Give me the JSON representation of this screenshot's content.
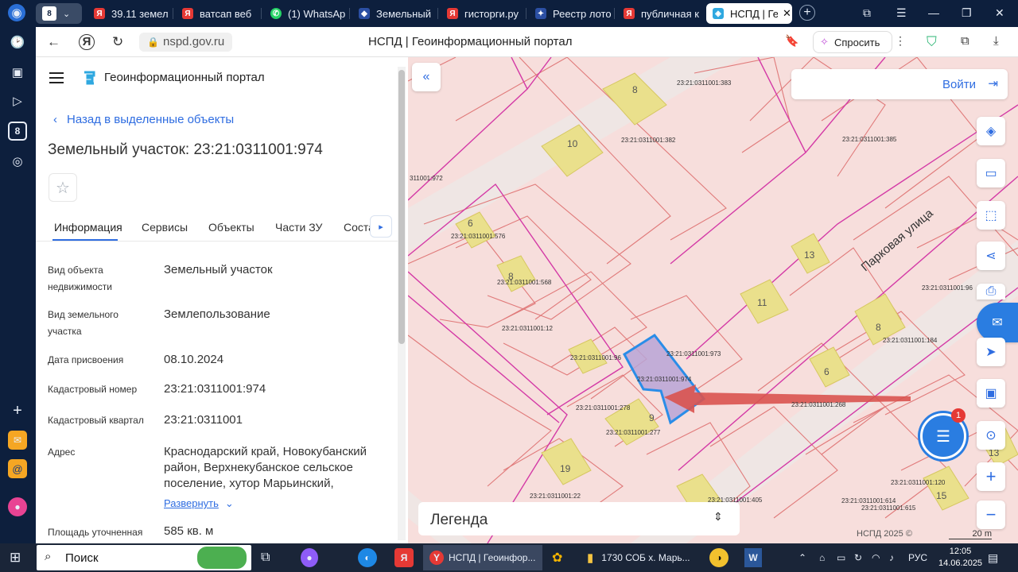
{
  "browser": {
    "tabs": [
      {
        "label": "39.11 земел",
        "color": "#e53935",
        "glyph": "Я"
      },
      {
        "label": "ватсап веб",
        "color": "#e53935",
        "glyph": "Я"
      },
      {
        "label": "(1) WhatsAp",
        "color": "#25d366",
        "glyph": "W"
      },
      {
        "label": "Земельный",
        "color": "#2b4fa3",
        "glyph": "З"
      },
      {
        "label": "гисторги.ру",
        "color": "#e53935",
        "glyph": "Я"
      },
      {
        "label": "Реестр лото",
        "color": "#2b4fa3",
        "glyph": "Р"
      },
      {
        "label": "публичная к",
        "color": "#e53935",
        "glyph": "Я"
      },
      {
        "label": "НСПД | Гео",
        "color": "#2fa8e0",
        "glyph": "Н"
      }
    ],
    "tab_count": "8",
    "url": "nspd.gov.ru",
    "page_title": "НСПД | Геоинформационный портал",
    "ask_label": "Спросить"
  },
  "panel": {
    "portal_title": "Геоинформационный портал",
    "back_label": "Назад в выделенные объекты",
    "object_title": "Земельный участок: 23:21:0311001:974",
    "tabs": [
      "Информация",
      "Сервисы",
      "Объекты",
      "Части ЗУ",
      "Соста"
    ],
    "fields": [
      {
        "label": "Вид объекта недвижимости",
        "value": "Земельный участок"
      },
      {
        "label": "Вид земельного участка",
        "value": "Землепользование"
      },
      {
        "label": "Дата присвоения",
        "value": "08.10.2024"
      },
      {
        "label": "Кадастровый номер",
        "value": "23:21:0311001:974"
      },
      {
        "label": "Кадастровый квартал",
        "value": "23:21:0311001"
      },
      {
        "label": "Адрес",
        "value": "Краснодарский край, Новокубанский район, Верхнекубанское сельское поселение, хутор Марьинский,"
      },
      {
        "label": "Площадь уточненная",
        "value": "585 кв. м"
      }
    ],
    "expand_label": "Развернуть"
  },
  "map": {
    "login_label": "Войти",
    "legend_label": "Легенда",
    "copyright": "НСПД 2025 ©",
    "scale_label": "20 m",
    "street_label": "Парковая улица",
    "parcels": [
      {
        "id": "23:21:0311001:383"
      },
      {
        "id": "23:21:0311001:382"
      },
      {
        "id": "23:21:0311001:385"
      },
      {
        "id": "311001:972"
      },
      {
        "id": "23:21:0311001:576"
      },
      {
        "id": "23:21:0311001:568"
      },
      {
        "id": "23:21:0311001:12"
      },
      {
        "id": "23:21:0311001:96"
      },
      {
        "id": "23:21:0311001:973"
      },
      {
        "id": "23:21:0311001:974"
      },
      {
        "id": "23:21:0311001:278"
      },
      {
        "id": "23:21:0311001:277"
      },
      {
        "id": "23:21:0311001:184"
      },
      {
        "id": "23:21:0311001:268"
      },
      {
        "id": "23:21:0311001:22"
      },
      {
        "id": "23:21:0311001:405"
      },
      {
        "id": "23:21:0311001:120"
      },
      {
        "id": "23:21:0311001:614"
      },
      {
        "id": "23:21:0311001:615"
      },
      {
        "id": "23:21:0311001:96"
      }
    ],
    "house_numbers": [
      "8",
      "10",
      "6",
      "8",
      "13",
      "11",
      "8",
      "6",
      "9",
      "19",
      "15",
      "13"
    ],
    "chat_badge": "1"
  },
  "taskbar": {
    "search_label": "Поиск",
    "items": [
      {
        "label": "НСПД | Геоинфор..."
      },
      {
        "label": "1730 СОБ х. Марь..."
      }
    ],
    "lang": "РУС",
    "time": "12:05",
    "date": "14.06.2025"
  }
}
